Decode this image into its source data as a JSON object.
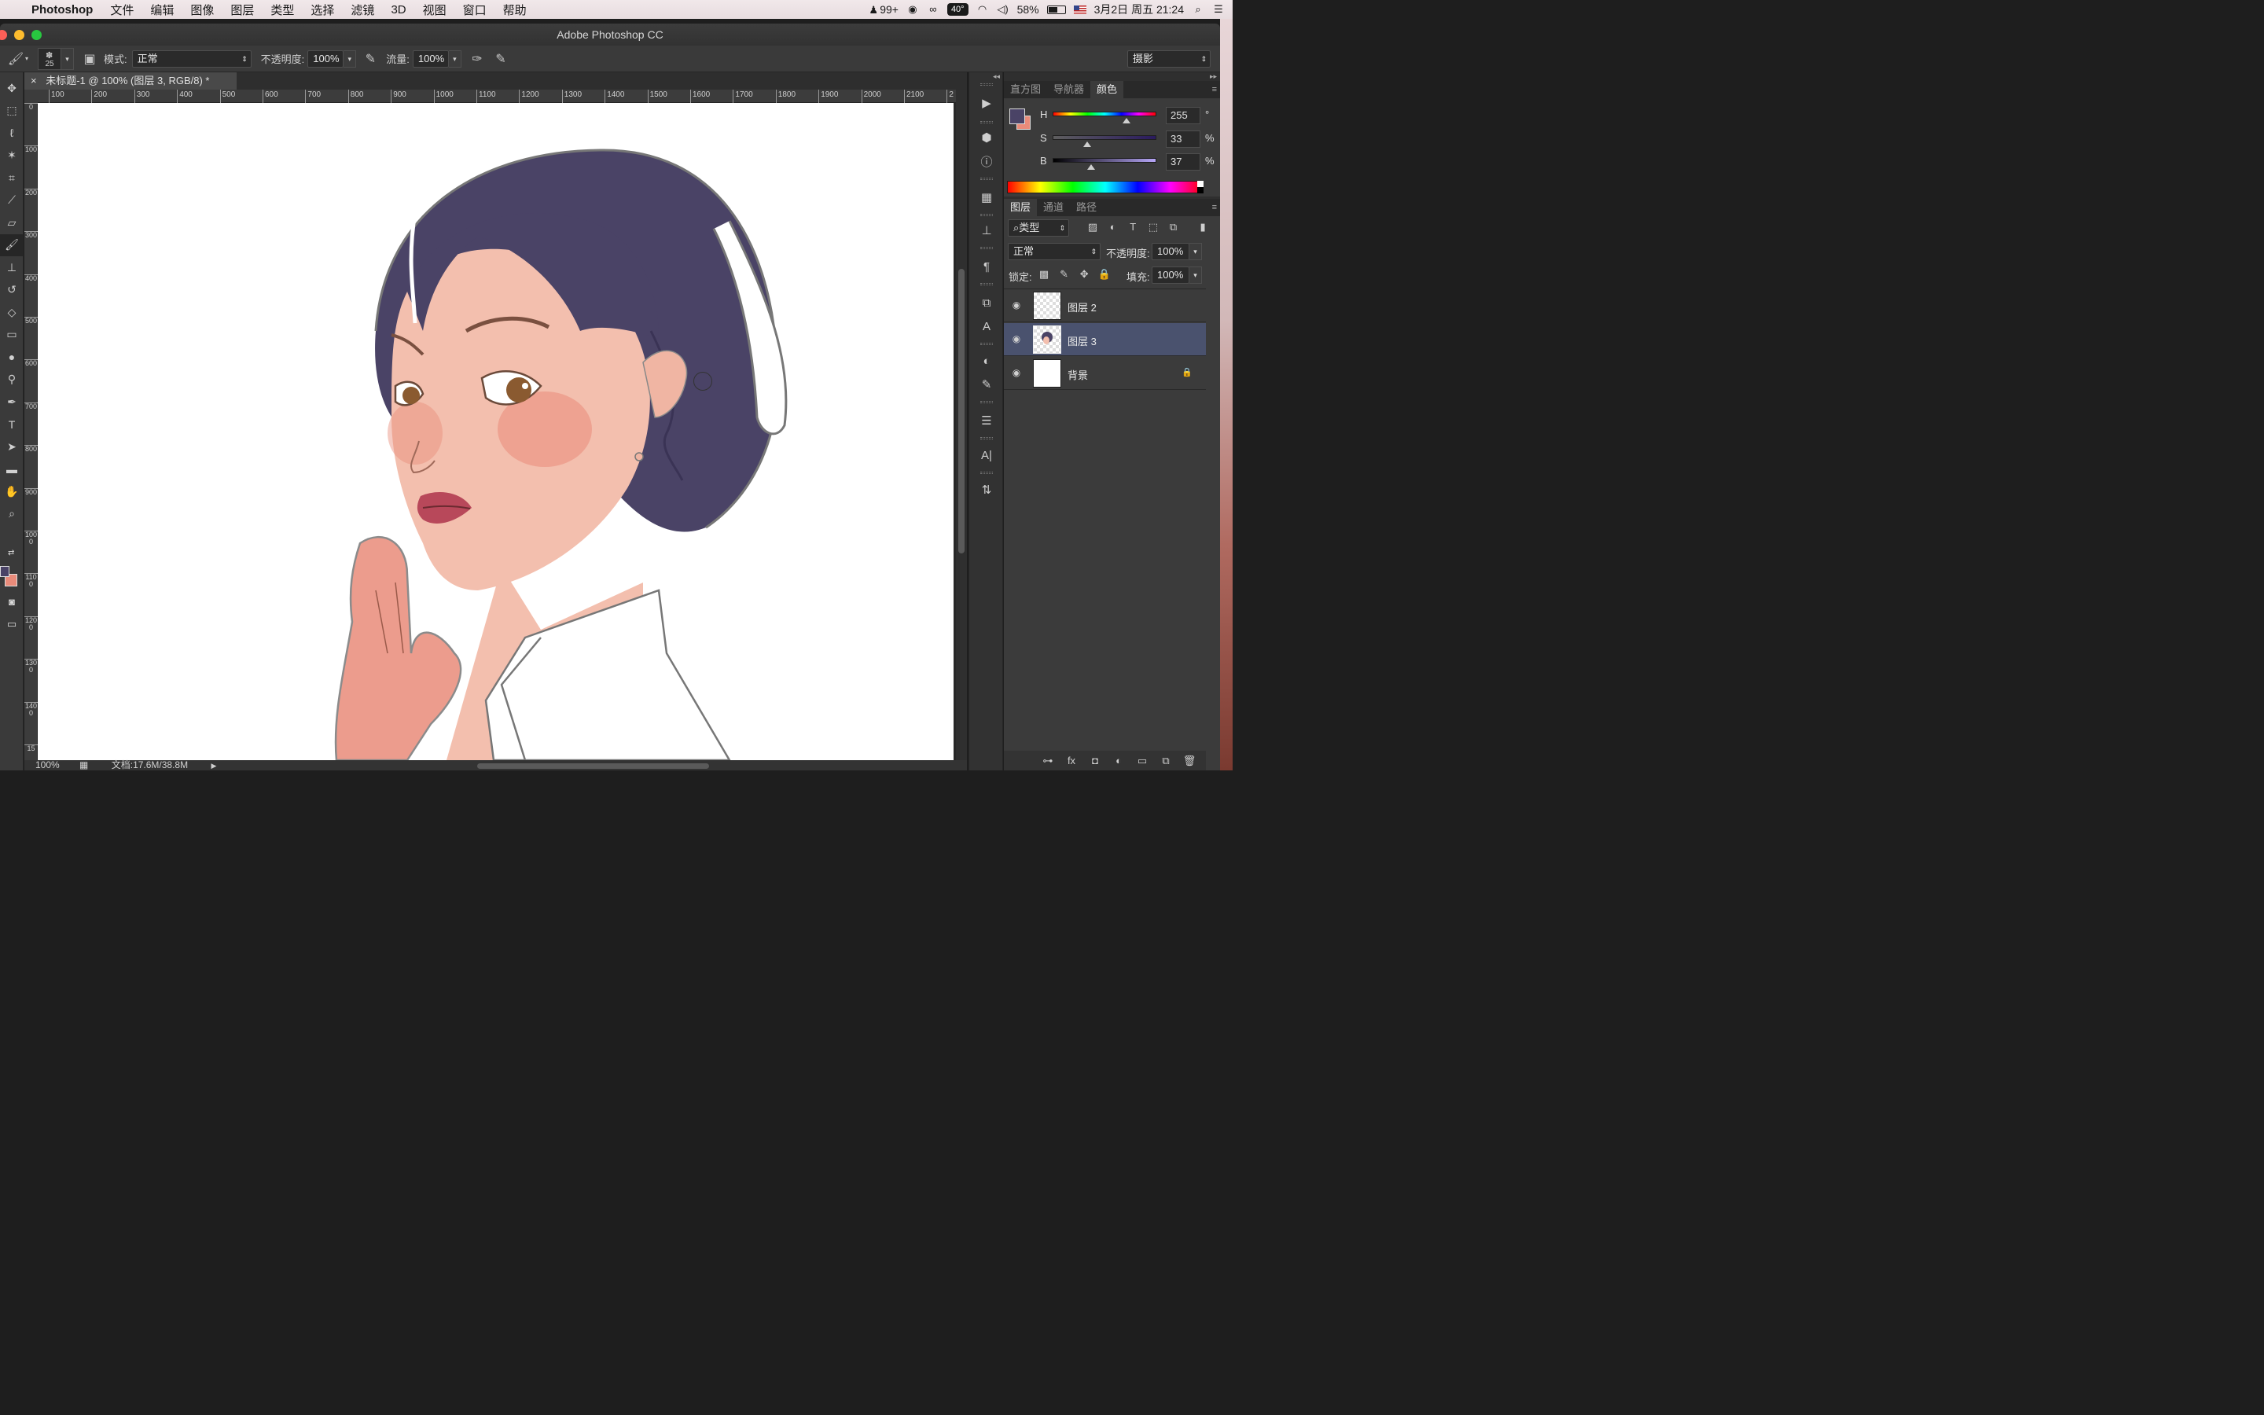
{
  "menubar": {
    "app_name": "Photoshop",
    "items": [
      "文件",
      "编辑",
      "图像",
      "图层",
      "类型",
      "选择",
      "滤镜",
      "3D",
      "视图",
      "窗口",
      "帮助"
    ],
    "qq_badge": "99+",
    "temperature": "40°",
    "battery_percent": "58%",
    "battery_level": 0.58,
    "datetime": "3月2日 周五  21:24"
  },
  "window": {
    "title": "Adobe Photoshop CC"
  },
  "options_bar": {
    "brush_size": "25",
    "mode_label": "模式:",
    "mode_value": "正常",
    "opacity_label": "不透明度:",
    "opacity_value": "100%",
    "flow_label": "流量:",
    "flow_value": "100%",
    "workspace_value": "摄影"
  },
  "document": {
    "tab_title": "未标题-1 @ 100% (图层 3, RGB/8) *",
    "close_glyph": "×",
    "ruler_top": [
      "100",
      "200",
      "300",
      "400",
      "500",
      "600",
      "700",
      "800",
      "900",
      "1000",
      "1100",
      "1200",
      "1300",
      "1400",
      "1500",
      "1600",
      "1700",
      "1800",
      "1900",
      "2000",
      "2100",
      "2"
    ],
    "ruler_left": [
      "0",
      "100",
      "200",
      "300",
      "400",
      "500",
      "600",
      "700",
      "800",
      "900",
      "1000",
      "1100",
      "1200",
      "1300",
      "1400",
      "15"
    ],
    "status_zoom": "100%",
    "status_doc": "文档:17.6M/38.8M"
  },
  "color_panel": {
    "tabs": [
      "直方图",
      "导航器",
      "颜色"
    ],
    "active_tab": "颜色",
    "h_label": "H",
    "h_value": "255",
    "h_unit": "°",
    "s_label": "S",
    "s_value": "33",
    "s_unit": "%",
    "b_label": "B",
    "b_value": "37",
    "b_unit": "%",
    "foreground_color": "#4a4366",
    "background_color": "#e98b7a"
  },
  "layers_panel": {
    "tabs": [
      "图层",
      "通道",
      "路径"
    ],
    "active_tab": "图层",
    "filter_label": "类型",
    "blend_mode": "正常",
    "opacity_label": "不透明度:",
    "opacity_value": "100%",
    "lock_label": "锁定:",
    "fill_label": "填充:",
    "fill_value": "100%",
    "layers": [
      {
        "name": "图层 2",
        "selected": false
      },
      {
        "name": "图层 3",
        "selected": true
      },
      {
        "name": "背景",
        "selected": false,
        "locked": true
      }
    ]
  },
  "icons": {
    "tools": [
      "move-tool-icon",
      "marquee-tool-icon",
      "lasso-tool-icon",
      "magic-wand-tool-icon",
      "crop-tool-icon",
      "eyedropper-tool-icon",
      "healing-brush-tool-icon",
      "brush-tool-icon",
      "clone-stamp-tool-icon",
      "history-brush-tool-icon",
      "eraser-tool-icon",
      "gradient-tool-icon",
      "blur-tool-icon",
      "dodge-tool-icon",
      "pen-tool-icon",
      "type-tool-icon",
      "path-selection-tool-icon",
      "rectangle-tool-icon",
      "hand-tool-icon",
      "zoom-tool-icon"
    ]
  }
}
